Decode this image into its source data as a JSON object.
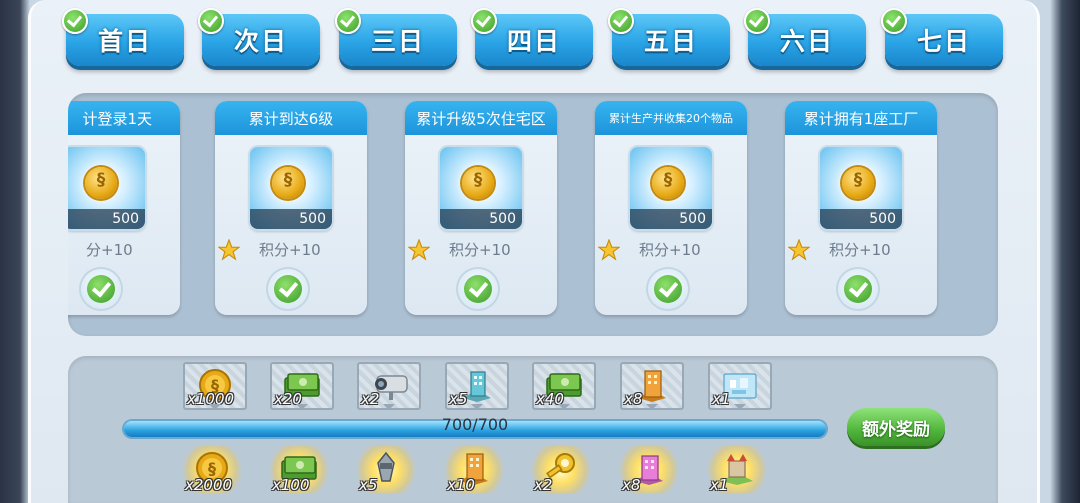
{
  "day_tabs": [
    {
      "label": "首日"
    },
    {
      "label": "次日"
    },
    {
      "label": "三日"
    },
    {
      "label": "四日"
    },
    {
      "label": "五日"
    },
    {
      "label": "六日"
    },
    {
      "label": "七日"
    }
  ],
  "tasks": [
    {
      "title": "计登录1天",
      "reward_qty": "500",
      "points": "分+10"
    },
    {
      "title": "累计到达6级",
      "reward_qty": "500",
      "points": "积分+10"
    },
    {
      "title": "累计升级5次住宅区",
      "reward_qty": "500",
      "points": "积分+10"
    },
    {
      "title": "累计生产并收集20个物品",
      "reward_qty": "500",
      "points": "积分+10"
    },
    {
      "title": "累计拥有1座工厂",
      "reward_qty": "500",
      "points": "积分+10"
    }
  ],
  "milestone_rewards": [
    {
      "icon": "coin-icon",
      "count": "x1000"
    },
    {
      "icon": "cash-icon",
      "count": "x20"
    },
    {
      "icon": "camera-icon",
      "count": "x2"
    },
    {
      "icon": "teal-building-icon",
      "count": "x5"
    },
    {
      "icon": "cash-icon",
      "count": "x40"
    },
    {
      "icon": "orange-building-icon",
      "count": "x8"
    },
    {
      "icon": "city-map-icon",
      "count": "x1"
    }
  ],
  "progress": {
    "text": "700/700",
    "value": 700,
    "max": 700
  },
  "extra_reward_button": "额外奖励",
  "final_rewards": [
    {
      "icon": "coin-icon",
      "count": "x2000"
    },
    {
      "icon": "cash-icon",
      "count": "x100"
    },
    {
      "icon": "drill-icon",
      "count": "x5"
    },
    {
      "icon": "orange-building-icon",
      "count": "x10"
    },
    {
      "icon": "key-icon",
      "count": "x2"
    },
    {
      "icon": "pink-building-icon",
      "count": "x8"
    },
    {
      "icon": "castle-icon",
      "count": "x1"
    }
  ],
  "colors": {
    "tab_blue": "#2aa4e6",
    "check_green": "#3f9d2a",
    "gold": "#e7a915",
    "extra_button_green": "#4fb53a"
  }
}
